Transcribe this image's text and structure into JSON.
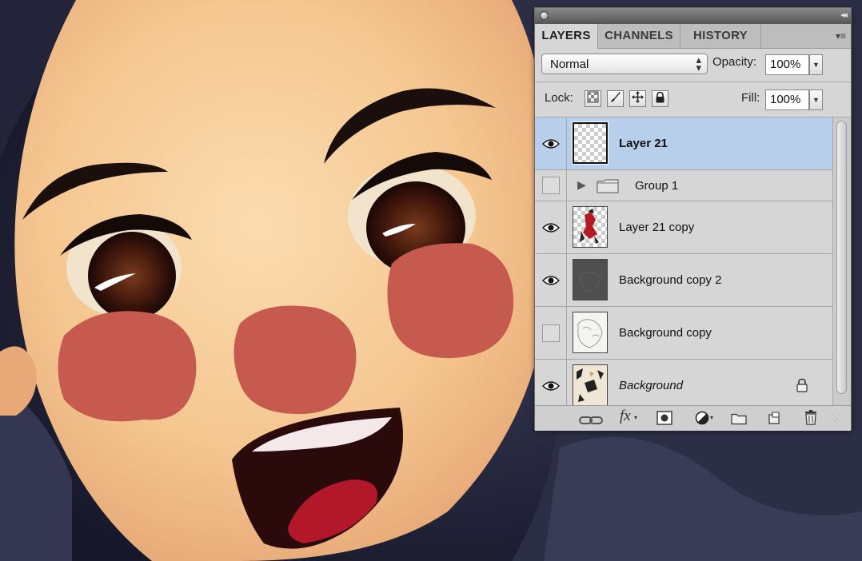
{
  "panel": {
    "tabs": [
      "LAYERS",
      "CHANNELS",
      "HISTORY"
    ],
    "collapse_glyph": "◂◂",
    "menu_glyph": "▾≡",
    "blend_mode": "Normal",
    "opacity_label": "Opacity:",
    "opacity_value": "100%",
    "lock_label": "Lock:",
    "fill_label": "Fill:",
    "fill_value": "100%",
    "lock_icons": [
      "lock-transparent-pixels-icon",
      "lock-image-pixels-icon",
      "lock-position-icon",
      "lock-all-icon"
    ],
    "layers": [
      {
        "name": "Layer 21",
        "visible": true,
        "selected": true,
        "thumb": "transparent"
      },
      {
        "name": "Group 1",
        "visible": false,
        "selected": false,
        "thumb": "folder"
      },
      {
        "name": "Layer 21 copy",
        "visible": true,
        "selected": false,
        "thumb": "figure"
      },
      {
        "name": "Background copy 2",
        "visible": true,
        "selected": false,
        "thumb": "dark"
      },
      {
        "name": "Background copy",
        "visible": false,
        "selected": false,
        "thumb": "sketch"
      },
      {
        "name": "Background",
        "visible": true,
        "selected": false,
        "thumb": "art",
        "locked": true
      }
    ],
    "bottom_icons": [
      "link-layers-icon",
      "layer-style-fx-icon",
      "add-mask-icon",
      "adjustment-layer-icon",
      "new-group-icon",
      "new-layer-icon",
      "delete-layer-icon"
    ],
    "fx_label": "fx"
  },
  "colors": {
    "selected_row": "#b7cfeb",
    "blush": "#c65a4e",
    "skin": "#f6c996"
  }
}
